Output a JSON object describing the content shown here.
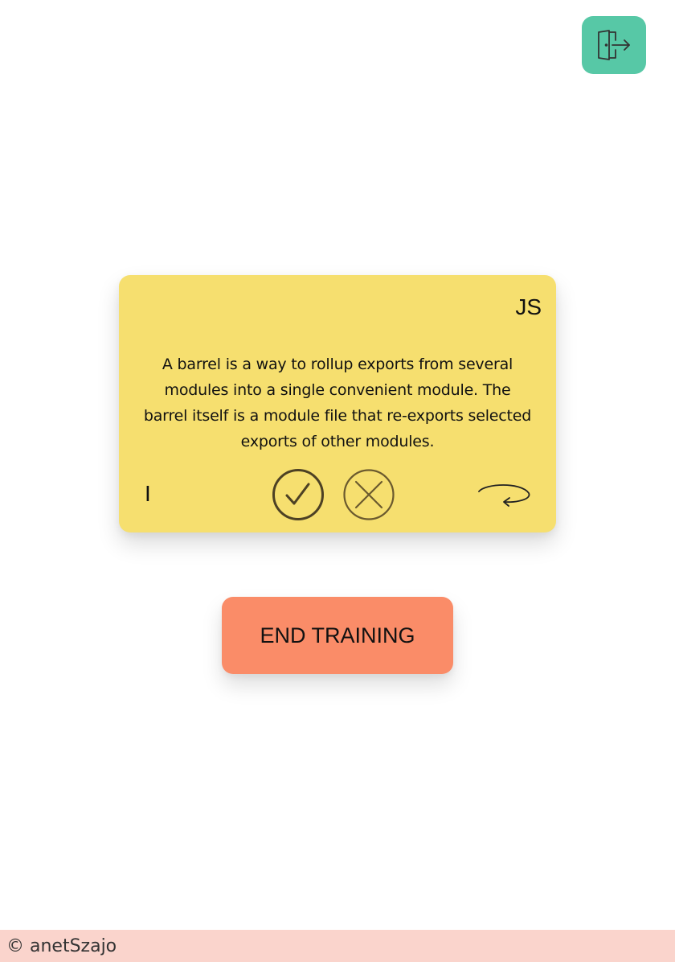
{
  "header": {
    "logout_icon": "logout-door-icon",
    "accent_color": "#57c8a6"
  },
  "card": {
    "category": "JS",
    "text": "A barrel is a way to rollup exports from several modules into a single convenient module. The barrel itself is a module file that re-exports selected exports of other modules.",
    "counter": "I",
    "background_color": "#f6df6f",
    "actions": {
      "correct_icon": "check-circle-icon",
      "wrong_icon": "x-circle-icon",
      "flip_icon": "flip-arrow-icon"
    }
  },
  "end_training": {
    "label": "END TRAINING",
    "color": "#fa8c68"
  },
  "footer": {
    "text": "© anetSzajo",
    "background_color": "#fad4cc"
  }
}
